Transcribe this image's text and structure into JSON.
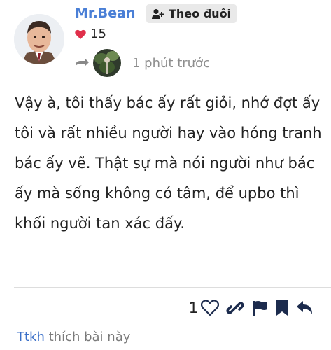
{
  "post": {
    "author": "Mr.Bean",
    "follow_label": "Theo đuôi",
    "like_count": "15",
    "time": "1 phút trước",
    "content": "Vậy à, tôi thấy bác ấy rất giỏi, nhớ đợt ấy tôi và rất nhiều người hay vào hóng tranh bác ấy vẽ. Thật sự mà nói người như bác ấy mà sống không có tâm, để upbo thì khối người tan xác đấy."
  },
  "actions": {
    "like_count": "1"
  },
  "footer": {
    "user": "Ttkh",
    "text": " thích bài này"
  },
  "colors": {
    "accent": "#4a7fd6",
    "heart": "#e0304b",
    "actions": "#1c2b4d"
  }
}
